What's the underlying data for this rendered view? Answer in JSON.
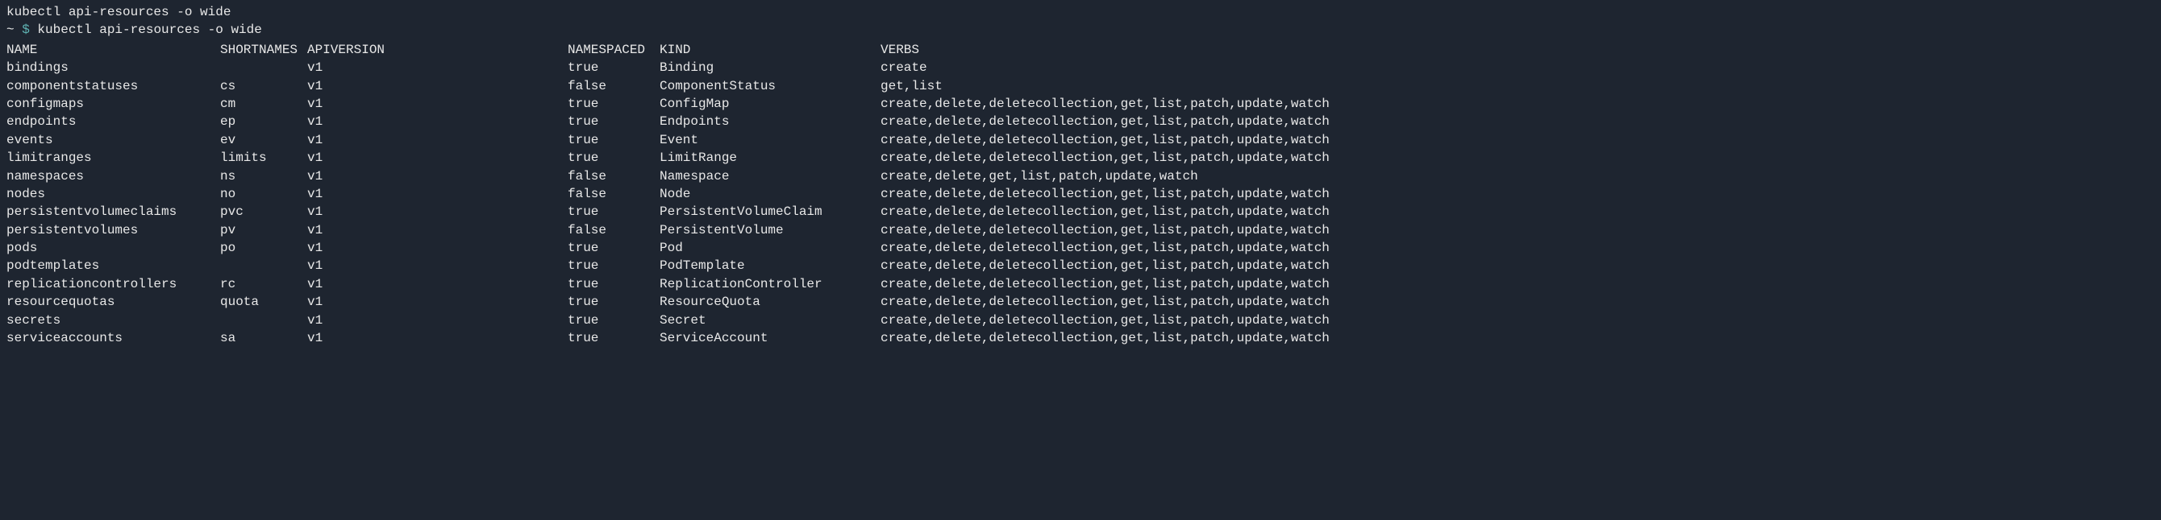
{
  "header_command": "kubectl api-resources -o wide",
  "prompt_prefix": "~ ",
  "prompt_symbol": "$",
  "prompt_command": " kubectl api-resources -o wide",
  "columns": {
    "name": "NAME",
    "shortnames": "SHORTNAMES",
    "apiversion": "APIVERSION",
    "namespaced": "NAMESPACED",
    "kind": "KIND",
    "verbs": "VERBS"
  },
  "rows": [
    {
      "name": "bindings",
      "shortnames": "",
      "apiversion": "v1",
      "namespaced": "true",
      "kind": "Binding",
      "verbs": "create"
    },
    {
      "name": "componentstatuses",
      "shortnames": "cs",
      "apiversion": "v1",
      "namespaced": "false",
      "kind": "ComponentStatus",
      "verbs": "get,list"
    },
    {
      "name": "configmaps",
      "shortnames": "cm",
      "apiversion": "v1",
      "namespaced": "true",
      "kind": "ConfigMap",
      "verbs": "create,delete,deletecollection,get,list,patch,update,watch"
    },
    {
      "name": "endpoints",
      "shortnames": "ep",
      "apiversion": "v1",
      "namespaced": "true",
      "kind": "Endpoints",
      "verbs": "create,delete,deletecollection,get,list,patch,update,watch"
    },
    {
      "name": "events",
      "shortnames": "ev",
      "apiversion": "v1",
      "namespaced": "true",
      "kind": "Event",
      "verbs": "create,delete,deletecollection,get,list,patch,update,watch"
    },
    {
      "name": "limitranges",
      "shortnames": "limits",
      "apiversion": "v1",
      "namespaced": "true",
      "kind": "LimitRange",
      "verbs": "create,delete,deletecollection,get,list,patch,update,watch"
    },
    {
      "name": "namespaces",
      "shortnames": "ns",
      "apiversion": "v1",
      "namespaced": "false",
      "kind": "Namespace",
      "verbs": "create,delete,get,list,patch,update,watch"
    },
    {
      "name": "nodes",
      "shortnames": "no",
      "apiversion": "v1",
      "namespaced": "false",
      "kind": "Node",
      "verbs": "create,delete,deletecollection,get,list,patch,update,watch"
    },
    {
      "name": "persistentvolumeclaims",
      "shortnames": "pvc",
      "apiversion": "v1",
      "namespaced": "true",
      "kind": "PersistentVolumeClaim",
      "verbs": "create,delete,deletecollection,get,list,patch,update,watch"
    },
    {
      "name": "persistentvolumes",
      "shortnames": "pv",
      "apiversion": "v1",
      "namespaced": "false",
      "kind": "PersistentVolume",
      "verbs": "create,delete,deletecollection,get,list,patch,update,watch"
    },
    {
      "name": "pods",
      "shortnames": "po",
      "apiversion": "v1",
      "namespaced": "true",
      "kind": "Pod",
      "verbs": "create,delete,deletecollection,get,list,patch,update,watch"
    },
    {
      "name": "podtemplates",
      "shortnames": "",
      "apiversion": "v1",
      "namespaced": "true",
      "kind": "PodTemplate",
      "verbs": "create,delete,deletecollection,get,list,patch,update,watch"
    },
    {
      "name": "replicationcontrollers",
      "shortnames": "rc",
      "apiversion": "v1",
      "namespaced": "true",
      "kind": "ReplicationController",
      "verbs": "create,delete,deletecollection,get,list,patch,update,watch"
    },
    {
      "name": "resourcequotas",
      "shortnames": "quota",
      "apiversion": "v1",
      "namespaced": "true",
      "kind": "ResourceQuota",
      "verbs": "create,delete,deletecollection,get,list,patch,update,watch"
    },
    {
      "name": "secrets",
      "shortnames": "",
      "apiversion": "v1",
      "namespaced": "true",
      "kind": "Secret",
      "verbs": "create,delete,deletecollection,get,list,patch,update,watch"
    },
    {
      "name": "serviceaccounts",
      "shortnames": "sa",
      "apiversion": "v1",
      "namespaced": "true",
      "kind": "ServiceAccount",
      "verbs": "create,delete,deletecollection,get,list,patch,update,watch"
    }
  ]
}
